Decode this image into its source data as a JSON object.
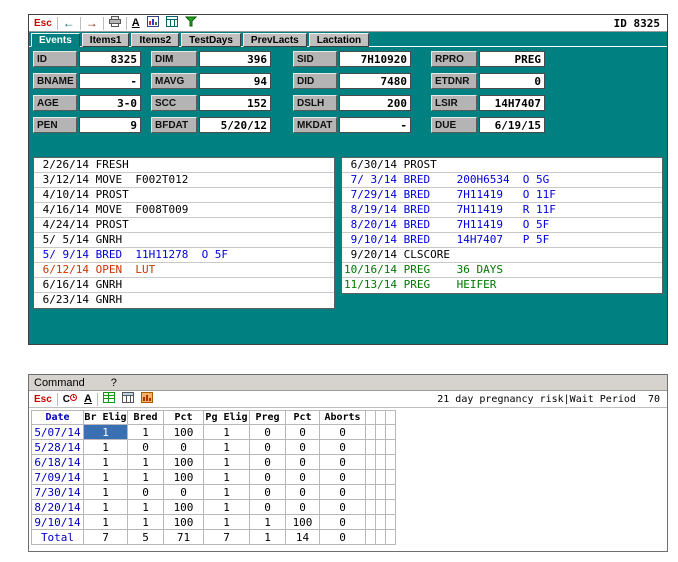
{
  "accent_colors": {
    "window_teal": "#008080",
    "event_blue": "#0000dd",
    "event_red": "#cc3300",
    "event_green": "#007700",
    "event_black": "#000000",
    "date_blue": "#0000bb",
    "selection_blue": "#3a70b2"
  },
  "cow_window": {
    "toolbar": {
      "esc_label": "Esc",
      "left_arrow": "←",
      "right_arrow": "→",
      "font_label": "A",
      "id_label": "ID 8325"
    },
    "tabs": [
      {
        "label": "Events"
      },
      {
        "label": "Items1"
      },
      {
        "label": "Items2"
      },
      {
        "label": "TestDays"
      },
      {
        "label": "PrevLacts"
      },
      {
        "label": "Lactation"
      }
    ],
    "fields": {
      "rows": [
        [
          {
            "label": "ID",
            "value": "8325"
          },
          {
            "label": "DIM",
            "value": "396"
          },
          {
            "label": "SID",
            "value": "7H10920"
          },
          {
            "label": "RPRO",
            "value": "PREG"
          }
        ],
        [
          {
            "label": "BNAME",
            "value": "-"
          },
          {
            "label": "MAVG",
            "value": "94"
          },
          {
            "label": "DID",
            "value": "7480"
          },
          {
            "label": "ETDNR",
            "value": "0"
          }
        ],
        [
          {
            "label": "AGE",
            "value": "3-0"
          },
          {
            "label": "SCC",
            "value": "152"
          },
          {
            "label": "DSLH",
            "value": "200"
          },
          {
            "label": "LSIR",
            "value": "14H7407"
          }
        ],
        [
          {
            "label": "PEN",
            "value": "9"
          },
          {
            "label": "BFDAT",
            "value": "5/20/12"
          },
          {
            "label": "MKDAT",
            "value": "-"
          },
          {
            "label": "DUE",
            "value": "6/19/15"
          }
        ]
      ]
    },
    "events_left": [
      {
        "text": " 2/26/14 FRESH",
        "color": "#000000"
      },
      {
        "text": " 3/12/14 MOVE  F002T012",
        "color": "#000000"
      },
      {
        "text": " 4/10/14 PROST",
        "color": "#000000"
      },
      {
        "text": " 4/16/14 MOVE  F008T009",
        "color": "#000000"
      },
      {
        "text": " 4/24/14 PROST",
        "color": "#000000"
      },
      {
        "text": " 5/ 5/14 GNRH",
        "color": "#000000"
      },
      {
        "text": " 5/ 9/14 BRED  11H11278  O 5F",
        "color": "#0000dd"
      },
      {
        "text": " 6/12/14 OPEN  LUT",
        "color": "#cc3300"
      },
      {
        "text": " 6/16/14 GNRH",
        "color": "#000000"
      },
      {
        "text": " 6/23/14 GNRH",
        "color": "#000000"
      }
    ],
    "events_right": [
      {
        "text": " 6/30/14 PROST",
        "color": "#000000"
      },
      {
        "text": " 7/ 3/14 BRED    200H6534  O 5G",
        "color": "#0000dd"
      },
      {
        "text": " 7/29/14 BRED    7H11419   O 11F",
        "color": "#0000dd"
      },
      {
        "text": " 8/19/14 BRED    7H11419   R 11F",
        "color": "#0000dd"
      },
      {
        "text": " 8/20/14 BRED    7H11419   O 5F",
        "color": "#0000dd"
      },
      {
        "text": " 9/10/14 BRED    14H7407   P 5F",
        "color": "#0000dd"
      },
      {
        "text": " 9/20/14 CLSCORE",
        "color": "#000000"
      },
      {
        "text": "10/16/14 PREG    36 DAYS",
        "color": "#007700"
      },
      {
        "text": "11/13/14 PREG    HEIFER",
        "color": "#007700"
      }
    ]
  },
  "command_window": {
    "title": "Command",
    "help_label": "?",
    "toolbar": {
      "esc_label": "Esc",
      "c_label": "C",
      "a_label": "A",
      "right_text": "21 day pregnancy risk|Wait Period  70"
    },
    "table": {
      "headers": [
        "Date",
        "Br Elig",
        "Bred",
        "Pct",
        "Pg Elig",
        "Preg",
        "Pct",
        "Aborts"
      ],
      "rows": [
        [
          "5/07/14",
          "1",
          "1",
          "100",
          "1",
          "0",
          "0",
          "0"
        ],
        [
          "5/28/14",
          "1",
          "0",
          "0",
          "1",
          "0",
          "0",
          "0"
        ],
        [
          "6/18/14",
          "1",
          "1",
          "100",
          "1",
          "0",
          "0",
          "0"
        ],
        [
          "7/09/14",
          "1",
          "1",
          "100",
          "1",
          "0",
          "0",
          "0"
        ],
        [
          "7/30/14",
          "1",
          "0",
          "0",
          "1",
          "0",
          "0",
          "0"
        ],
        [
          "8/20/14",
          "1",
          "1",
          "100",
          "1",
          "0",
          "0",
          "0"
        ],
        [
          "9/10/14",
          "1",
          "1",
          "100",
          "1",
          "1",
          "100",
          "0"
        ],
        [
          "Total",
          "7",
          "5",
          "71",
          "7",
          "1",
          "14",
          "0"
        ]
      ]
    }
  }
}
